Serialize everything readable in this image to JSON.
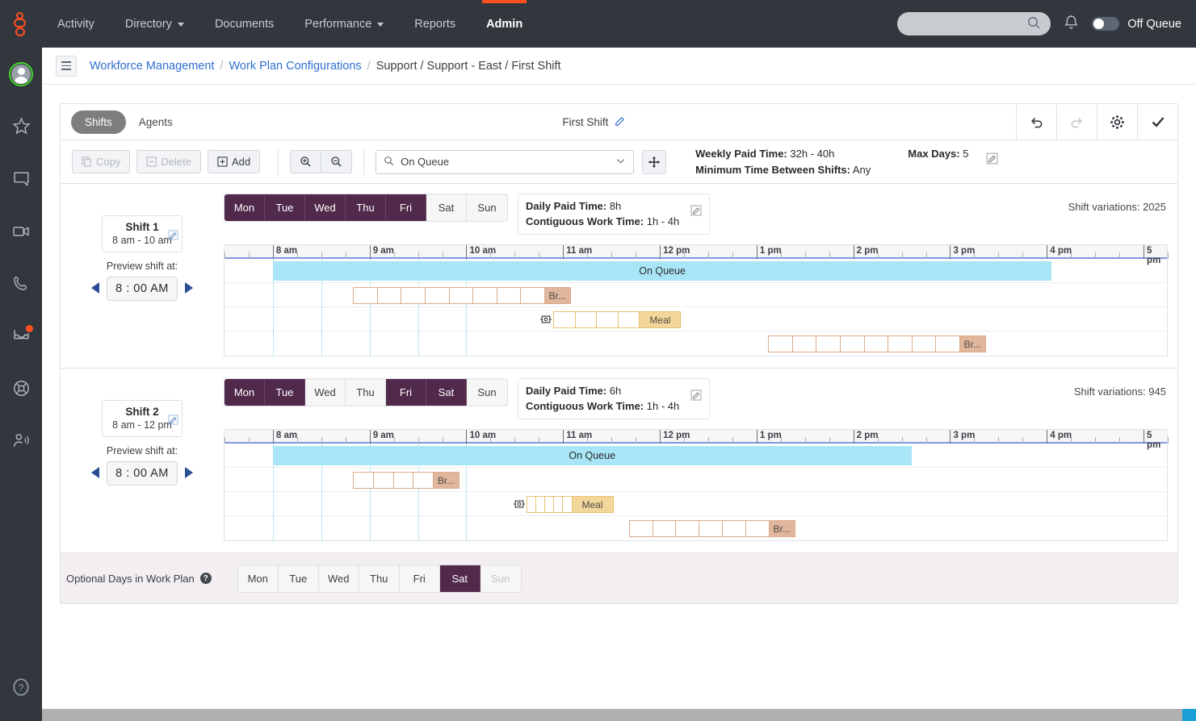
{
  "topnav": {
    "items": [
      {
        "label": "Activity",
        "caret": false,
        "active": false
      },
      {
        "label": "Directory",
        "caret": true,
        "active": false
      },
      {
        "label": "Documents",
        "caret": false,
        "active": false
      },
      {
        "label": "Performance",
        "caret": true,
        "active": false
      },
      {
        "label": "Reports",
        "caret": false,
        "active": false
      },
      {
        "label": "Admin",
        "caret": false,
        "active": true
      }
    ],
    "search_placeholder": "",
    "queue_status_label": "Off Queue",
    "accent_color": "#ff4f1f",
    "bar_color": "#32373e"
  },
  "rail": {
    "icons": [
      "avatar",
      "star-icon",
      "chat-icon",
      "video-icon",
      "phone-icon",
      "inbox-icon",
      "lifebuoy-icon",
      "agent-assist-icon",
      "help-icon"
    ]
  },
  "breadcrumb": {
    "root": "Workforce Management",
    "section": "Work Plan Configurations",
    "current": "Support / Support - East / First Shift",
    "separator": "/"
  },
  "panel_head": {
    "tab_shifts": "Shifts",
    "tab_agents": "Agents",
    "title": "First Shift",
    "undo_title": "undo",
    "redo_title": "redo",
    "settings_title": "settings",
    "confirm_title": "save"
  },
  "toolbar": {
    "copy_label": "Copy",
    "delete_label": "Delete",
    "add_label": "Add",
    "zoom_in_title": "zoom in",
    "zoom_out_title": "zoom out",
    "activity_select_value": "On Queue",
    "move_title": "move",
    "weekly_paid_time_label": "Weekly Paid Time:",
    "weekly_paid_time_value": "32h - 40h",
    "max_days_label": "Max Days:",
    "max_days_value": "5",
    "min_time_label": "Minimum Time Between Shifts:",
    "min_time_value": "Any"
  },
  "days": [
    "Mon",
    "Tue",
    "Wed",
    "Thu",
    "Fri",
    "Sat",
    "Sun"
  ],
  "shifts": [
    {
      "name": "Shift 1",
      "range": "8 am - 10 am",
      "preview_label": "Preview shift at:",
      "preview_time": "8 : 00  AM",
      "selected_days": [
        "Mon",
        "Tue",
        "Wed",
        "Thu",
        "Fri"
      ],
      "daily_paid_time_label": "Daily Paid Time:",
      "daily_paid_time_value": "8h",
      "contiguous_label": "Contiguous Work Time:",
      "contiguous_value": "1h - 4h",
      "variations_label": "Shift variations: 2025",
      "rows": [
        {
          "type": "onqueue",
          "label": "On Queue",
          "start": 8.0,
          "end": 16.05,
          "slots": 0
        },
        {
          "type": "break",
          "label": "Br...",
          "start": 8.83,
          "end": 11.08,
          "slots": 8
        },
        {
          "type": "meal",
          "label": "Meal",
          "start": 10.9,
          "end": 12.22,
          "slots": 4,
          "anchor": true
        },
        {
          "type": "break",
          "label": "Br...",
          "start": 13.12,
          "end": 15.37,
          "slots": 8
        }
      ]
    },
    {
      "name": "Shift 2",
      "range": "8 am - 12 pm",
      "preview_label": "Preview shift at:",
      "preview_time": "8 : 00  AM",
      "selected_days": [
        "Mon",
        "Tue",
        "Fri",
        "Sat"
      ],
      "daily_paid_time_label": "Daily Paid Time:",
      "daily_paid_time_value": "6h",
      "contiguous_label": "Contiguous Work Time:",
      "contiguous_value": "1h - 4h",
      "variations_label": "Shift variations: 945",
      "rows": [
        {
          "type": "onqueue",
          "label": "On Queue",
          "start": 8.0,
          "end": 14.6,
          "slots": 0
        },
        {
          "type": "break",
          "label": "Br...",
          "start": 8.83,
          "end": 9.93,
          "slots": 4
        },
        {
          "type": "meal",
          "label": "Meal",
          "start": 10.62,
          "end": 11.52,
          "slots": 5,
          "anchor": true
        },
        {
          "type": "break",
          "label": "Br...",
          "start": 11.68,
          "end": 13.4,
          "slots": 6
        }
      ]
    }
  ],
  "timeline": {
    "start_hour": 7.5,
    "end_hour": 17.3,
    "hour_labels": [
      "8 am",
      "9 am",
      "10 am",
      "11 am",
      "12 pm",
      "1 pm",
      "2 pm",
      "3 pm",
      "4 pm",
      "5 pm"
    ],
    "hour_values": [
      8,
      9,
      10,
      11,
      12,
      13,
      14,
      15,
      16,
      17
    ],
    "guide_hours": [
      8,
      8.5,
      9,
      9.5,
      10
    ]
  },
  "optional_days": {
    "label": "Optional Days in Work Plan",
    "help": "?",
    "selected": [
      "Sat"
    ],
    "disabled": [
      "Sun"
    ]
  },
  "colors": {
    "day_selected": "#51294b",
    "onqueue": "#a8e6f7",
    "break": "#e0b69c",
    "meal": "#f3d79a",
    "link": "#2f6fd0"
  }
}
